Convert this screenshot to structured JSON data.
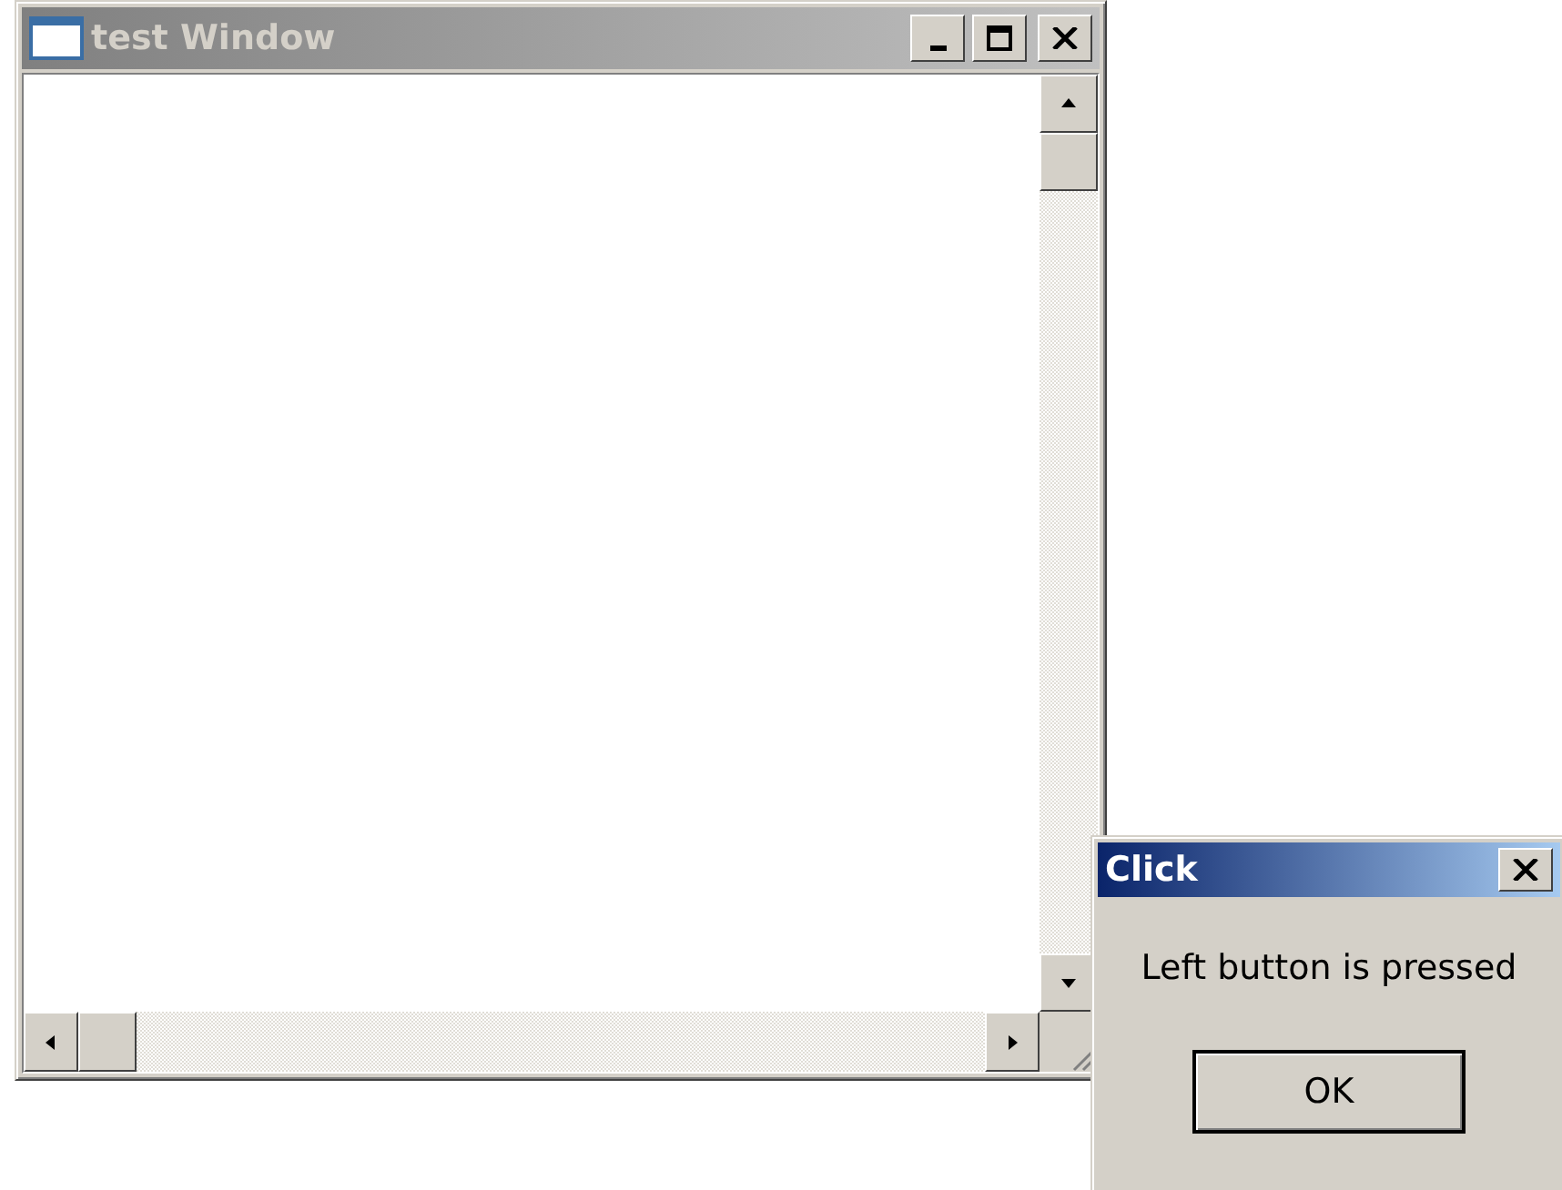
{
  "windows": [
    {
      "title": "test Window",
      "active": false,
      "kind": "main"
    },
    {
      "title": "Click",
      "active": true,
      "kind": "dialog",
      "message": "Left button is pressed",
      "buttons": [
        "OK"
      ]
    }
  ]
}
